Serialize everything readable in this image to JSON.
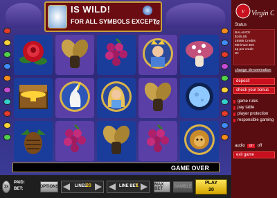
{
  "banner": {
    "line1": "IS WILD!",
    "line2": "FOR ALL SYMBOLS EXCEPT",
    "number": "02"
  },
  "reels": [
    [
      "rose",
      "mistletoe",
      "grapes",
      "prince",
      "mushroom"
    ],
    [
      "treasure",
      "unicorn",
      "princess",
      "mistletoe",
      "moon"
    ],
    [
      "pinecone",
      "grapes",
      "mistletoe",
      "grapes",
      "lion"
    ]
  ],
  "status_message": "GAME OVER",
  "bottom_bar": {
    "paid_label": "PAID:",
    "bet_label": "BET:",
    "options_label": "OPTIONS",
    "lines_label": "LINES",
    "lines_value": "20",
    "line_bet_label": "LINE BET",
    "line_bet_value": "1",
    "max_bet_label": "MAX BET",
    "gamble_label": "GAMBLE",
    "play_label": "PLAY",
    "play_value": "20",
    "left_icon_label": "1x"
  },
  "panel": {
    "logo_text": "Virgin Casino",
    "status_heading": "Status",
    "balance_label": "BALANCE",
    "balance_value": "$165.85",
    "credits_text": "16585 Credits",
    "min_bet_label": "Minimum Bet",
    "min_bet_value": "1p per credit",
    "player_id_label": "ID:",
    "change_denomination": "change denomination",
    "deposit_label": "deposit",
    "bonus_label": "check your bonus",
    "links": [
      "game rules",
      "pay table",
      "player protection",
      "responsible gaming"
    ],
    "audio_label": "audio",
    "audio_on": "on",
    "audio_off": "off",
    "exit_label": "exit game"
  },
  "colors": {
    "panel_bg": "#5a0d10",
    "accent_red": "#d8101e",
    "reel_blue": "#1a3d9c",
    "reel_purple": "#5a3fa6"
  }
}
